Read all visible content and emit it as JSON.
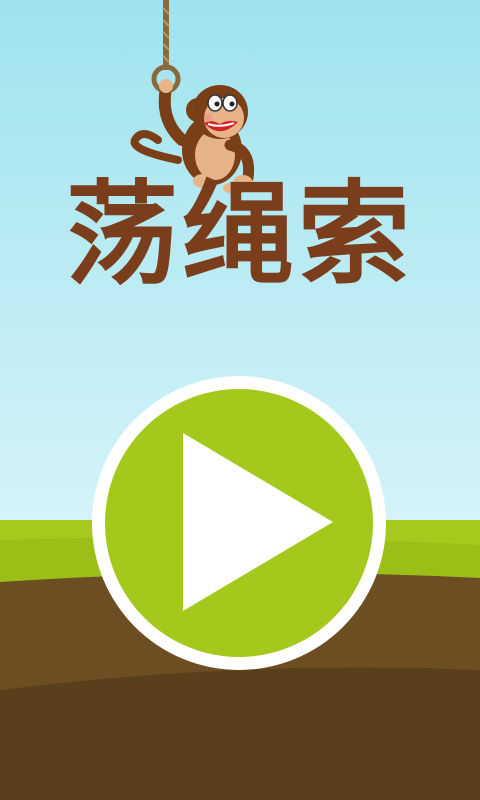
{
  "game": {
    "title": "荡绳索",
    "play_button_icon": "play-icon"
  },
  "colors": {
    "sky_top": "#9fe3ee",
    "sky_bottom": "#d4f3f7",
    "grass": "#a6c91e",
    "dirt": "#6d4e22",
    "dirt_dark": "#5a3f1c",
    "title": "#7a3e1c",
    "play_button": "#a5c81d"
  }
}
